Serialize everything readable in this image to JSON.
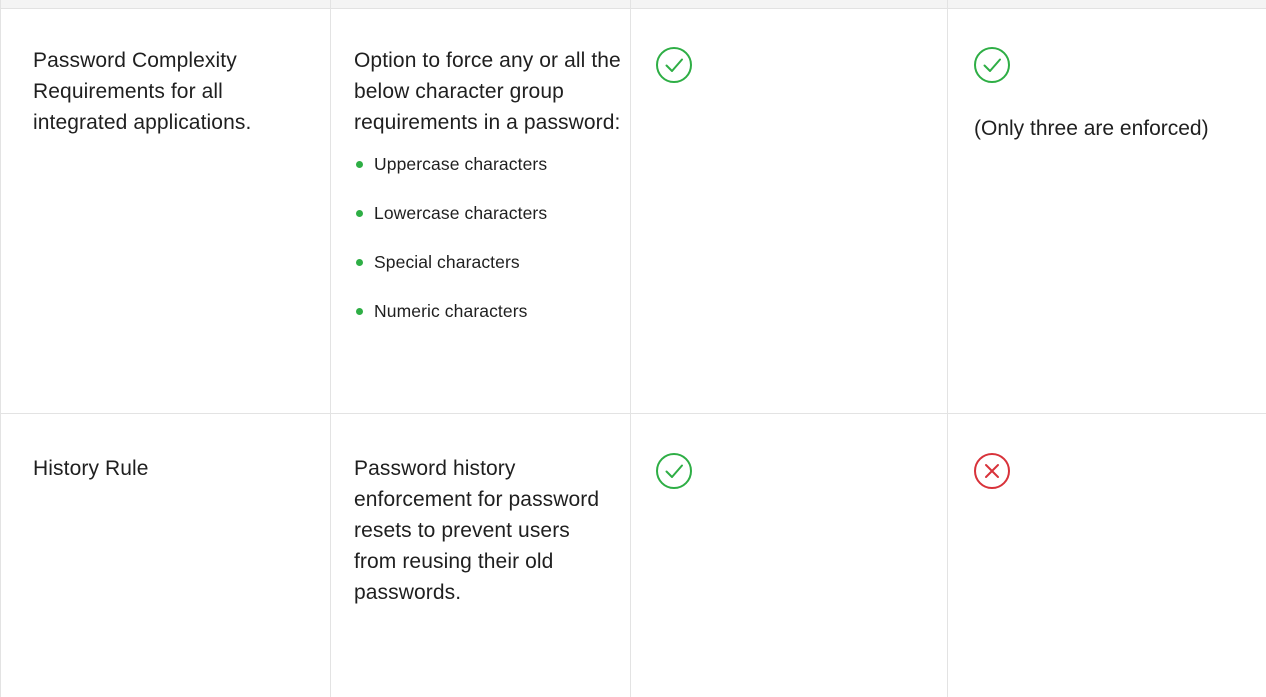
{
  "colors": {
    "check": "#2eae45",
    "cross": "#d8323a",
    "bullet": "#2eae45",
    "grid": "#e3e3e3"
  },
  "rows": [
    {
      "feature": "Password Complexity Requirements for all integrated applications.",
      "description": "Option to force any or all  the below character group requirements in a password:",
      "bullets": [
        "Uppercase characters",
        "Lowercase characters",
        "Special characters",
        "Numeric characters"
      ],
      "col3_icon": "check-circle-icon",
      "col4_icon": "check-circle-icon",
      "col4_note": "(Only three are enforced)"
    },
    {
      "feature": "History Rule",
      "description": "Password history enforcement for password resets to prevent users from reusing their old passwords.",
      "col3_icon": "check-circle-icon",
      "col4_icon": "x-circle-icon"
    }
  ]
}
